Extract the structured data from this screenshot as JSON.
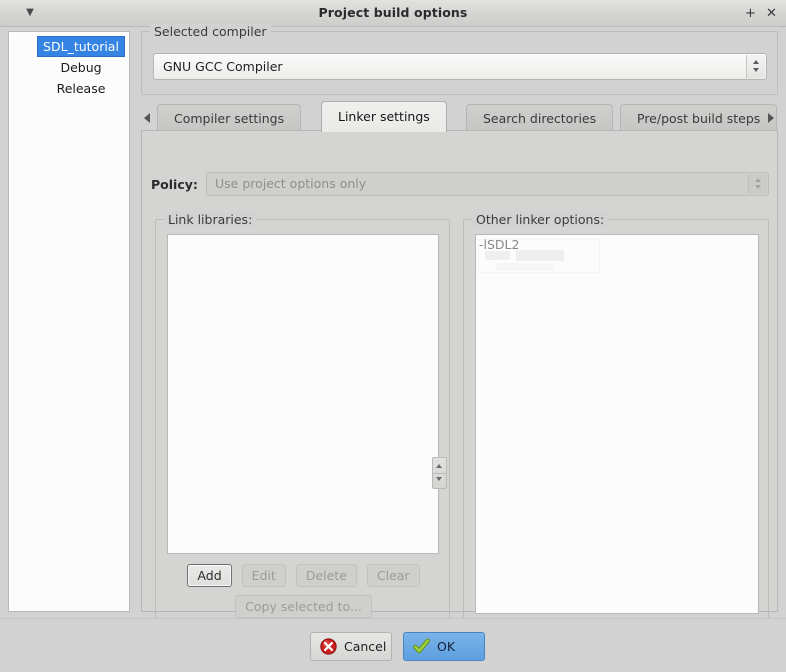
{
  "window": {
    "title": "Project build options",
    "menu_icon": "window-menu-chevron-down-icon",
    "maximize_icon": "maximize-icon",
    "maximize_glyph": "+",
    "close_icon": "close-icon",
    "close_glyph": "✕",
    "menu_glyph": "▼"
  },
  "tree": {
    "items": [
      {
        "label": "SDL_tutorial",
        "selected": true
      },
      {
        "label": "Debug",
        "selected": false
      },
      {
        "label": "Release",
        "selected": false
      }
    ]
  },
  "compiler": {
    "group_title": "Selected compiler",
    "selected": "GNU GCC Compiler"
  },
  "tabs": {
    "scroll_left_icon": "triangle-left-icon",
    "scroll_right_icon": "triangle-right-icon",
    "items": [
      {
        "label": "Compiler settings",
        "active": false
      },
      {
        "label": "Linker settings",
        "active": true
      },
      {
        "label": "Search directories",
        "active": false
      },
      {
        "label": "Pre/post build steps",
        "active": false
      }
    ]
  },
  "policy": {
    "label": "Policy:",
    "value": "Use project options only",
    "disabled": true
  },
  "link_libraries": {
    "group_title": "Link libraries:",
    "items": [],
    "buttons": [
      {
        "label": "Add",
        "disabled": false,
        "focused": true
      },
      {
        "label": "Edit",
        "disabled": true,
        "focused": false
      },
      {
        "label": "Delete",
        "disabled": true,
        "focused": false
      },
      {
        "label": "Clear",
        "disabled": true,
        "focused": false
      }
    ],
    "copy_button": {
      "label": "Copy selected to...",
      "disabled": true
    }
  },
  "move_spinner": {
    "up_icon": "move-up-icon",
    "down_icon": "move-down-icon"
  },
  "other_linker_options": {
    "group_title": "Other linker options:",
    "value": "-lSDL2"
  },
  "actions": {
    "cancel": {
      "label": "Cancel",
      "icon": "cancel-x-circle-icon"
    },
    "ok": {
      "label": "OK",
      "icon": "check-mark-icon",
      "default": true
    }
  },
  "colors": {
    "window_bg": "#d2d2d2",
    "titlebar_bg": "#d7d7d5",
    "selection_blue": "#3584e4",
    "ok_button_blue": "#5d9fe0",
    "cancel_red": "#cc1f1f",
    "check_green": "#8ec63f",
    "list_bg": "#fcfcfc",
    "text": "#2e3436",
    "disabled_text": "#9b9b99"
  }
}
